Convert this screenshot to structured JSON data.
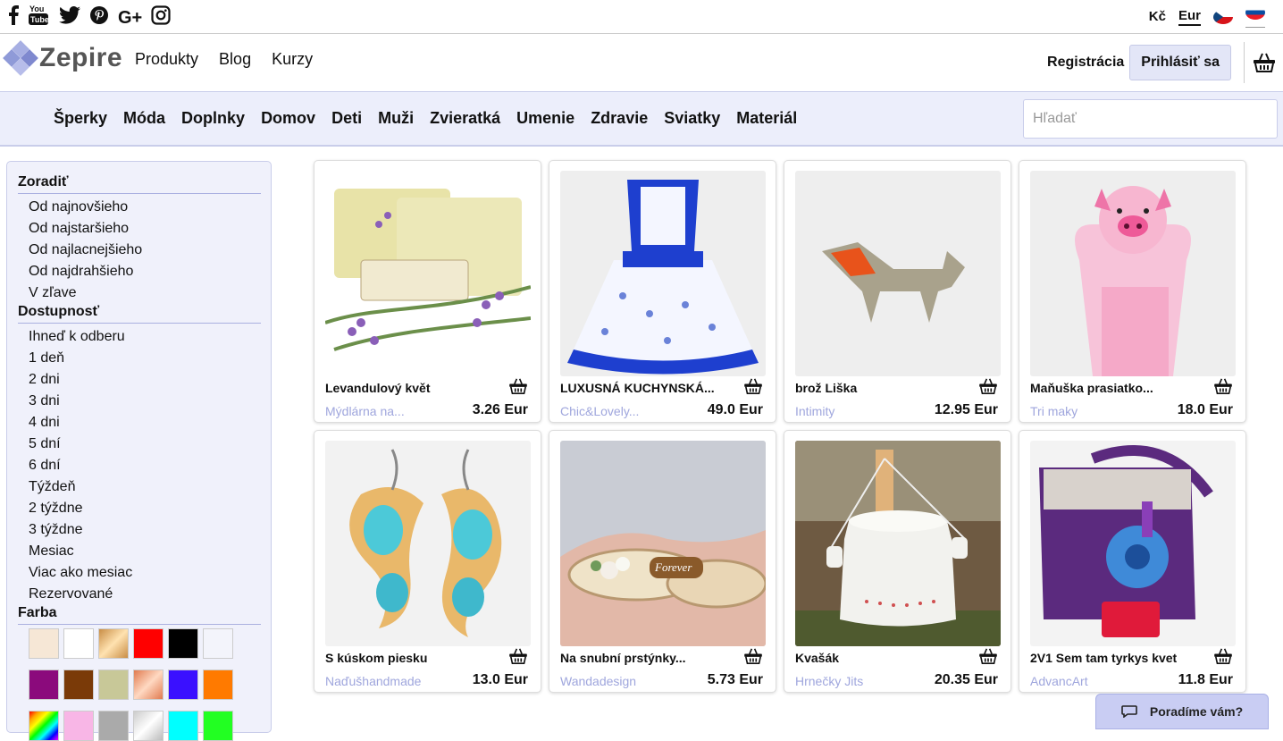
{
  "social": {
    "icons": [
      "facebook-icon",
      "youtube-icon",
      "twitter-icon",
      "pinterest-icon",
      "google-plus-icon",
      "instagram-icon"
    ],
    "youtube_label": "You Tube",
    "gplus_label": "G+"
  },
  "currency": {
    "czk": "Kč",
    "eur": "Eur"
  },
  "header": {
    "logo": "Zepire",
    "nav": [
      "Produkty",
      "Blog",
      "Kurzy"
    ],
    "register": "Registrácia",
    "login": "Prihlásiť sa"
  },
  "categories": [
    "Šperky",
    "Móda",
    "Doplnky",
    "Domov",
    "Deti",
    "Muži",
    "Zvieratká",
    "Umenie",
    "Zdravie",
    "Sviatky",
    "Materiál"
  ],
  "search": {
    "placeholder": "Hľadať"
  },
  "sidebar": {
    "sort_title": "Zoradiť",
    "sort": [
      "Od najnovšieho",
      "Od najstaršieho",
      "Od najlacnejšieho",
      "Od najdrahšieho",
      "V zľave"
    ],
    "avail_title": "Dostupnosť",
    "avail": [
      "Ihneď k odberu",
      "1 deň",
      "2 dni",
      "3 dni",
      "4 dni",
      "5 dní",
      "6 dní",
      "Týždeň",
      "2 týždne",
      "3 týždne",
      "Mesiac",
      "Viac ako mesiac",
      "Rezervované"
    ],
    "color_title": "Farba",
    "colors": [
      "#f6e7d6",
      "#ffffff",
      "gold",
      "#ff0000",
      "#000000",
      "#f3f4fb",
      "#8b0a7c",
      "#7a3a08",
      "#c8c898",
      "copper",
      "#3a10ff",
      "#ff7a00",
      "rainbow",
      "#f8b6e6",
      "#aaaaaa",
      "silver",
      "#00ffff",
      "#22ff22"
    ]
  },
  "products": [
    {
      "name": "Levandulový květ",
      "shop": "Mýdlárna na...",
      "price": "3.26 Eur",
      "img": "soap"
    },
    {
      "name": "LUXUSNÁ KUCHYNSKÁ...",
      "shop": "Chic&Lovely...",
      "price": "49.0 Eur",
      "img": "apron"
    },
    {
      "name": "brož Liška",
      "shop": "Intimity",
      "price": "12.95 Eur",
      "img": "fox"
    },
    {
      "name": "Maňuška prasiatko...",
      "shop": "Tri maky",
      "price": "18.0 Eur",
      "img": "pig"
    },
    {
      "name": "S kúskom piesku",
      "shop": "Naďušhandmade",
      "price": "13.0 Eur",
      "img": "earrings"
    },
    {
      "name": "Na snubní prstýnky...",
      "shop": "Wandadesign",
      "price": "5.73 Eur",
      "img": "rings"
    },
    {
      "name": "Kvašák",
      "shop": "Hrnečky Jits",
      "price": "20.35 Eur",
      "img": "pot"
    },
    {
      "name": "2V1 Sem tam tyrkys kvet",
      "shop": "AdvancArt",
      "price": "11.8 Eur",
      "img": "bag"
    }
  ],
  "chat": {
    "label": "Poradíme vám?"
  }
}
